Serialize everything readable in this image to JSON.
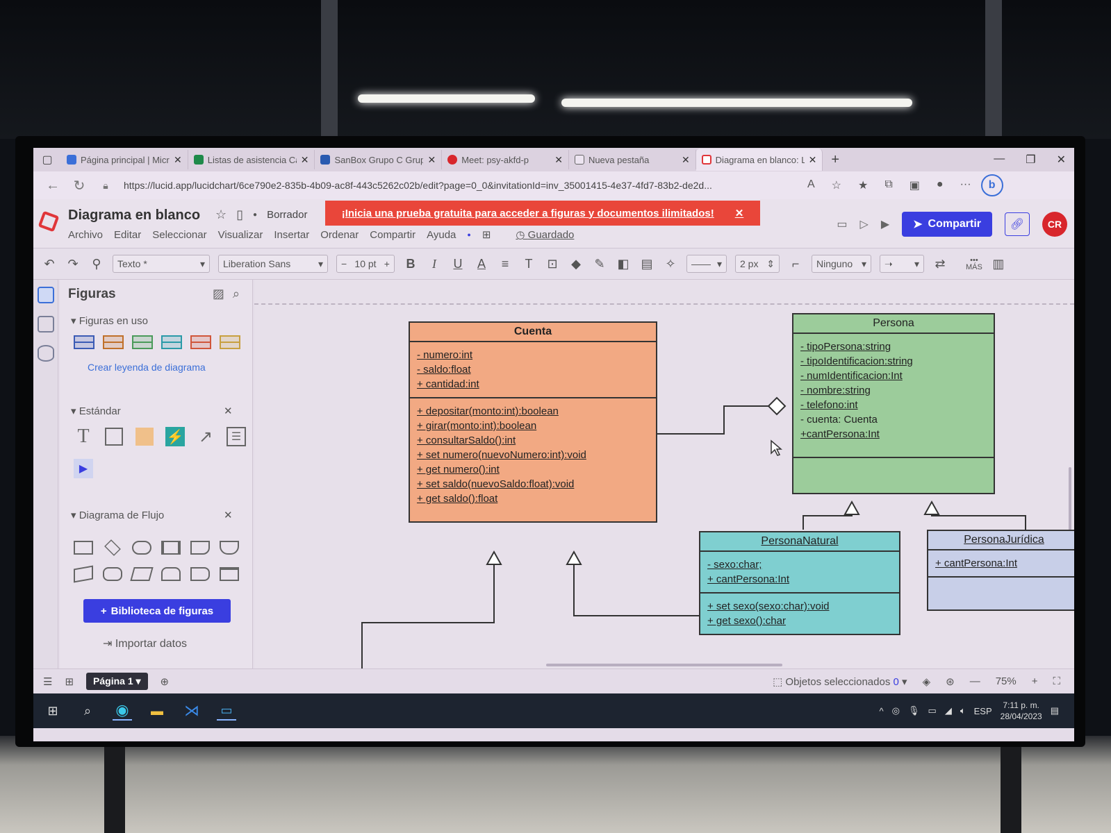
{
  "browser": {
    "tabs": [
      {
        "label": "Página principal | Micr",
        "active": false
      },
      {
        "label": "Listas de asistencia Ca",
        "active": false
      },
      {
        "label": "SanBox Grupo C Grup",
        "active": false
      },
      {
        "label": "Meet: psy-akfd-p",
        "active": false
      },
      {
        "label": "Nueva pestaña",
        "active": false
      },
      {
        "label": "Diagrama en blanco: L",
        "active": true
      }
    ],
    "new_tab": "+",
    "url": "https://lucid.app/lucidchart/6ce790e2-835b-4b09-ac8f-443c5262c02b/edit?page=0_0&invitationId=inv_35001415-4e37-4fd7-83b2-de2d..."
  },
  "header": {
    "doc_title": "Diagrama en blanco",
    "status": "Borrador",
    "promo": "¡Inicia una prueba gratuita para acceder a figuras y documentos ilimitados!",
    "menu": [
      "Archivo",
      "Editar",
      "Seleccionar",
      "Visualizar",
      "Insertar",
      "Ordenar",
      "Compartir",
      "Ayuda"
    ],
    "saved": "Guardado",
    "share": "Compartir",
    "avatar": "CR"
  },
  "toolbar": {
    "style": "Texto *",
    "font": "Liberation Sans",
    "font_size": "10 pt",
    "line_width": "2 px",
    "endpoint": "Ninguno",
    "more": "MÁS"
  },
  "panel": {
    "title": "Figuras",
    "in_use": "Figuras en uso",
    "legend_link": "Crear leyenda de diagrama",
    "standard": "Estándar",
    "flow": "Diagrama de Flujo",
    "library_button": "Biblioteca de figuras",
    "import": "Importar datos",
    "swatch_colors": [
      "#3b5bb5",
      "#c0702a",
      "#4a9a5a",
      "#2a9aa8",
      "#d0563a",
      "#c8a040"
    ]
  },
  "diagram": {
    "cuenta": {
      "name": "Cuenta",
      "attributes": [
        "- numero:int",
        "- saldo:float",
        "+ cantidad:int"
      ],
      "methods": [
        "+ depositar(monto:int):boolean",
        "+ girar(monto:int):boolean",
        "+ consultarSaldo():int",
        "+ set numero(nuevoNumero:int):void",
        "+ get numero():int",
        "+ set saldo(nuevoSaldo:float):void",
        "+ get saldo():float"
      ]
    },
    "persona": {
      "name": "Persona",
      "attributes": [
        "- tipoPersona:string",
        "- tipoIdentificacion:string",
        "- numIdentificacion:Int",
        "- nombre:string",
        "- telefono:int",
        "- cuenta: Cuenta",
        "+cantPersona:Int"
      ]
    },
    "natural": {
      "name": "PersonaNatural",
      "attributes": [
        "- sexo:char;",
        "+ cantPersona:Int"
      ],
      "methods": [
        "+ set sexo(sexo:char):void",
        "+ get sexo():char"
      ]
    },
    "juridica": {
      "name": "PersonaJurídica",
      "attributes": [
        "+ cantPersona:Int"
      ]
    },
    "colors": {
      "cuenta": "#f2a983",
      "persona": "#9ccc9b",
      "natural": "#7fcfd0",
      "juridica": "#c8cfe8"
    }
  },
  "statusbar": {
    "page": "Página 1",
    "selected": "Objetos seleccionados",
    "selected_count": "0",
    "zoom": "75%"
  },
  "taskbar": {
    "time": "7:11 p. m.",
    "date": "28/04/2023",
    "lang": "ESP"
  }
}
